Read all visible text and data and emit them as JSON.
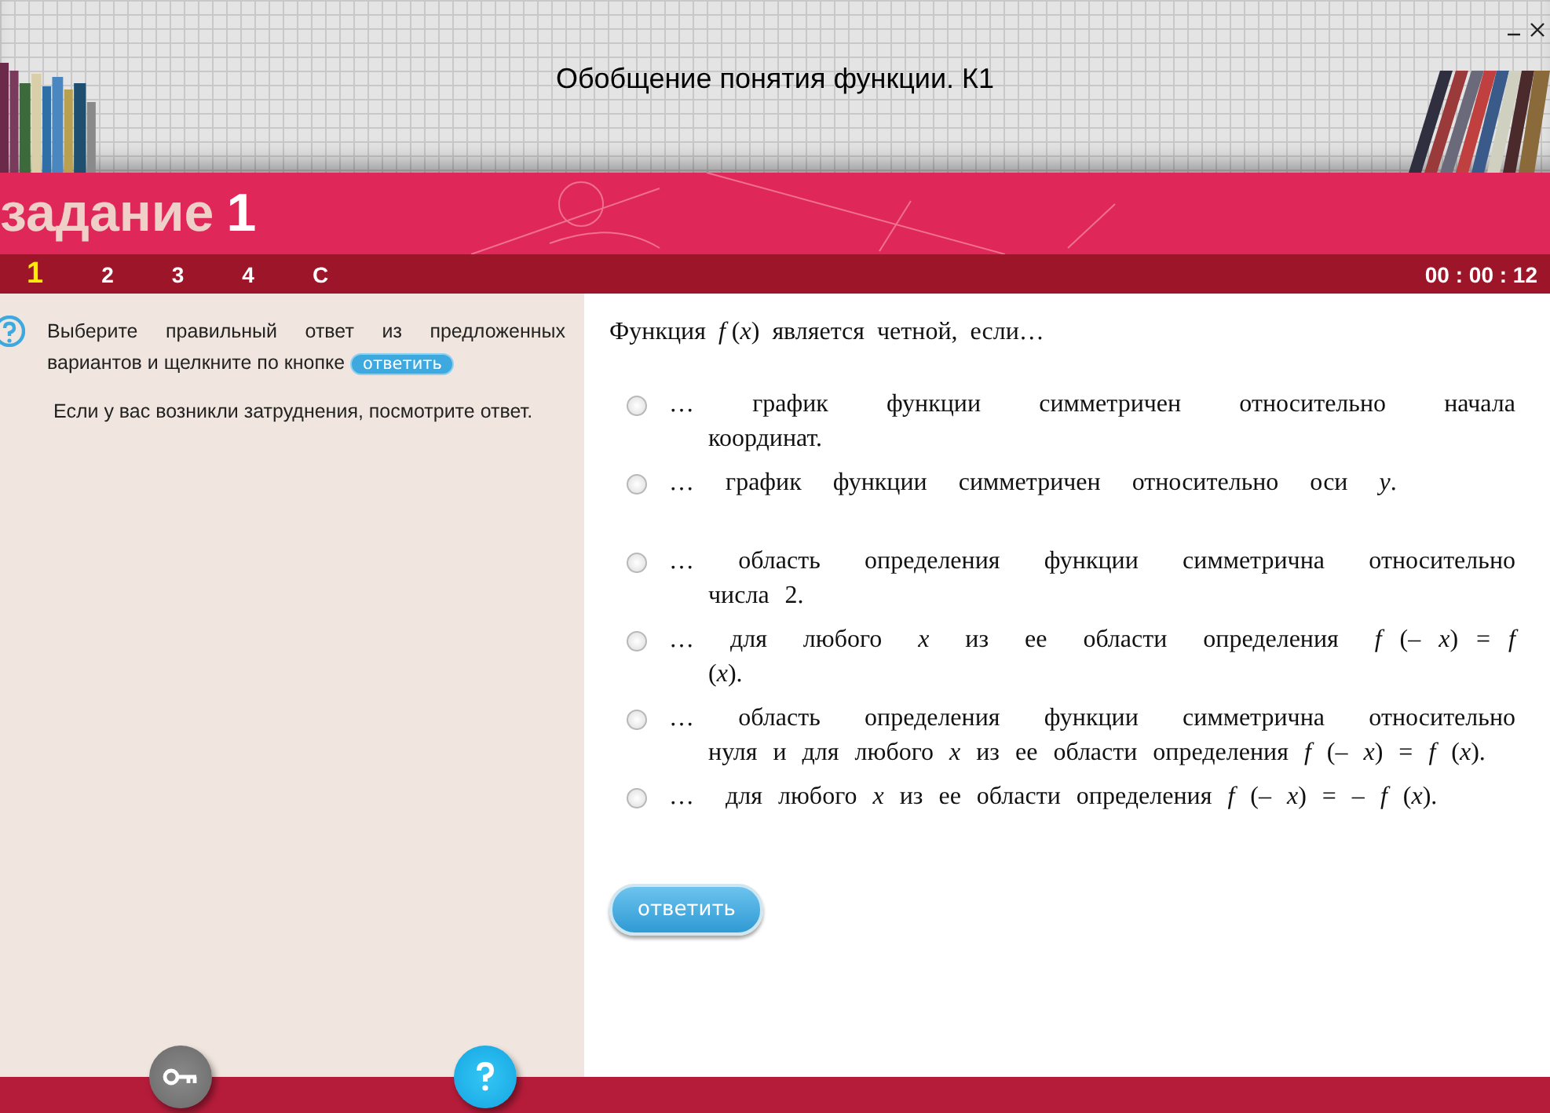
{
  "window": {
    "title": "Обобщение понятия функции. К1"
  },
  "task_heading": {
    "label": "задание",
    "number": "1"
  },
  "task_nav": [
    {
      "label": "1",
      "selected": true
    },
    {
      "label": "2",
      "selected": false
    },
    {
      "label": "3",
      "selected": false
    },
    {
      "label": "4",
      "selected": false
    },
    {
      "label": "С",
      "selected": false
    }
  ],
  "timer": "00 : 00 : 12",
  "instructions": {
    "text": "Выберите правильный ответ из предложенных вариантов и щелкните по кнопке",
    "inline_button": "ответить",
    "hint": "Если у вас возникли затруднения, посмотрите ответ."
  },
  "question": "Функция  *f* (*x*)  является  четной,  если…",
  "options": [
    {
      "text": "…  график  функции  симметричен  относительно  начала  координат.",
      "selected": false
    },
    {
      "text": "…  график  функции  симметричен  относительно  оси  *y*.",
      "selected": false
    },
    {
      "text": "…  область  определения  функции  симметрична  относительно числа 2.",
      "selected": false
    },
    {
      "text": "…  для  любого  *x*  из  ее  области  определения  *f* (– *x*) = *f* (*x*).",
      "selected": false
    },
    {
      "text": "…  область  определения  функции  симметрична  относительно нуля и для любого *x* из ее области определения *f* (– *x*) = *f* (*x*).",
      "selected": false
    },
    {
      "text": "…  для любого *x* из ее области определения *f* (– *x*) = – *f* (*x*).",
      "selected": false
    }
  ],
  "submit_button": "ответить"
}
